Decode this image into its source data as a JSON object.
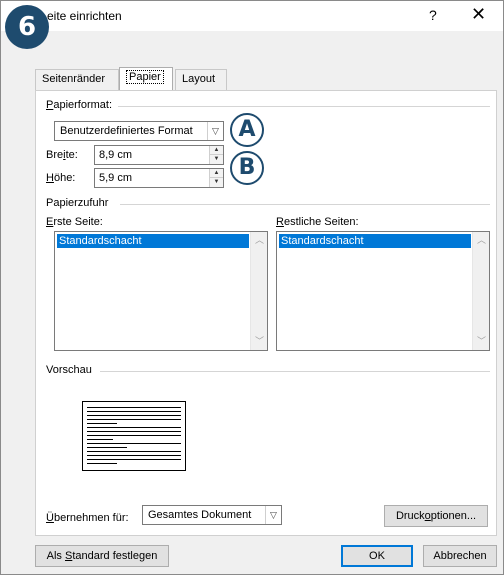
{
  "window": {
    "title": "Seite einrichten",
    "title_visible": "eite einrichten",
    "help": "?",
    "close": "✕"
  },
  "step_badge": "6",
  "tabs": [
    {
      "label": "Seitenränder",
      "active": false
    },
    {
      "label": "Papier",
      "active": true
    },
    {
      "label": "Layout",
      "active": false
    }
  ],
  "papierformat": {
    "section_label_u": "P",
    "section_label_rest": "apierformat:",
    "selected": "Benutzerdefiniertes Format",
    "callout": "A",
    "breite_label_a": "Bre",
    "breite_label_u": "i",
    "breite_label_b": "te:",
    "breite_value": "8,9 cm",
    "hoehe_label_u": "H",
    "hoehe_label_rest": "öhe:",
    "hoehe_value": "5,9 cm",
    "callout_b": "B"
  },
  "papierzufuhr": {
    "section_label": "Papierzufuhr",
    "erste_u": "E",
    "erste_rest": "rste Seite:",
    "erste_item": "Standardschacht",
    "restliche_u": "R",
    "restliche_rest": "estliche Seiten:",
    "restliche_item": "Standardschacht"
  },
  "vorschau": {
    "section_label": "Vorschau"
  },
  "apply": {
    "label_u": "Ü",
    "label_rest": "bernehmen für:",
    "value": "Gesamtes Dokument",
    "druck_a": "Druck",
    "druck_u": "o",
    "druck_b": "ptionen..."
  },
  "footer": {
    "default_a": "Als ",
    "default_u": "S",
    "default_b": "tandard festlegen",
    "ok": "OK",
    "cancel": "Abbrechen"
  },
  "icons": {
    "dropdown": "chevron-down-icon",
    "spin_up": "spin-up-icon",
    "spin_down": "spin-down-icon",
    "scroll_up": "scroll-up-icon",
    "scroll_down": "scroll-down-icon"
  }
}
